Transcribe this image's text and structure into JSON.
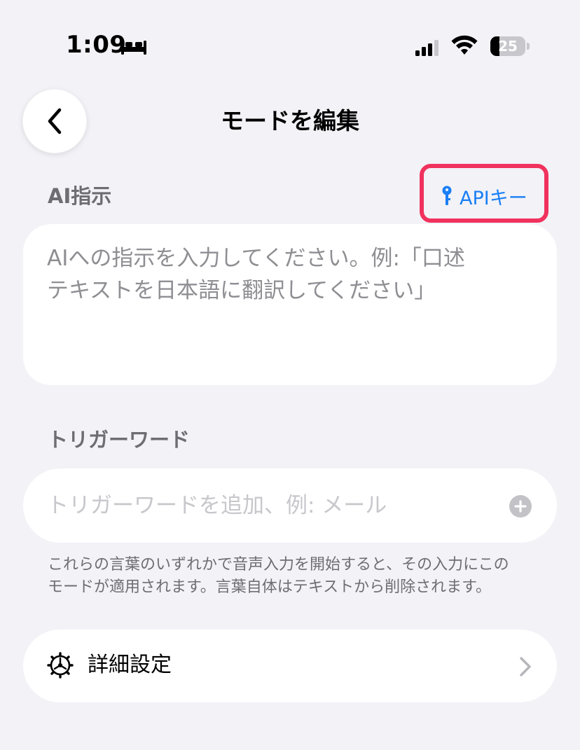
{
  "status_bar": {
    "time": "1:09",
    "battery_level": "25",
    "icons": [
      "bed-icon",
      "cellular-signal-icon",
      "wifi-icon",
      "battery-icon"
    ]
  },
  "nav": {
    "title": "モードを編集",
    "back_icon": "chevron-left-icon"
  },
  "ai_instructions": {
    "label": "AI指示",
    "placeholder_line1": "AIへの指示を入力してください。例:「口述",
    "placeholder_line2": "テキストを日本語に翻訳してください」",
    "api_key_label": "APIキー",
    "api_key_icon": "key-icon",
    "highlight_color": "#f0325d",
    "accent_color": "#1a7ff5"
  },
  "trigger_words": {
    "label": "トリガーワード",
    "placeholder": "トリガーワードを追加、例: メール",
    "add_icon": "plus-circle-icon",
    "helper_line1": "これらの言葉のいずれかで音声入力を開始すると、その入力にこの",
    "helper_line2": "モードが適用されます。言葉自体はテキストから削除されます。"
  },
  "advanced": {
    "label": "詳細設定",
    "icon": "gear-icon",
    "chevron": "chevron-right-icon"
  }
}
